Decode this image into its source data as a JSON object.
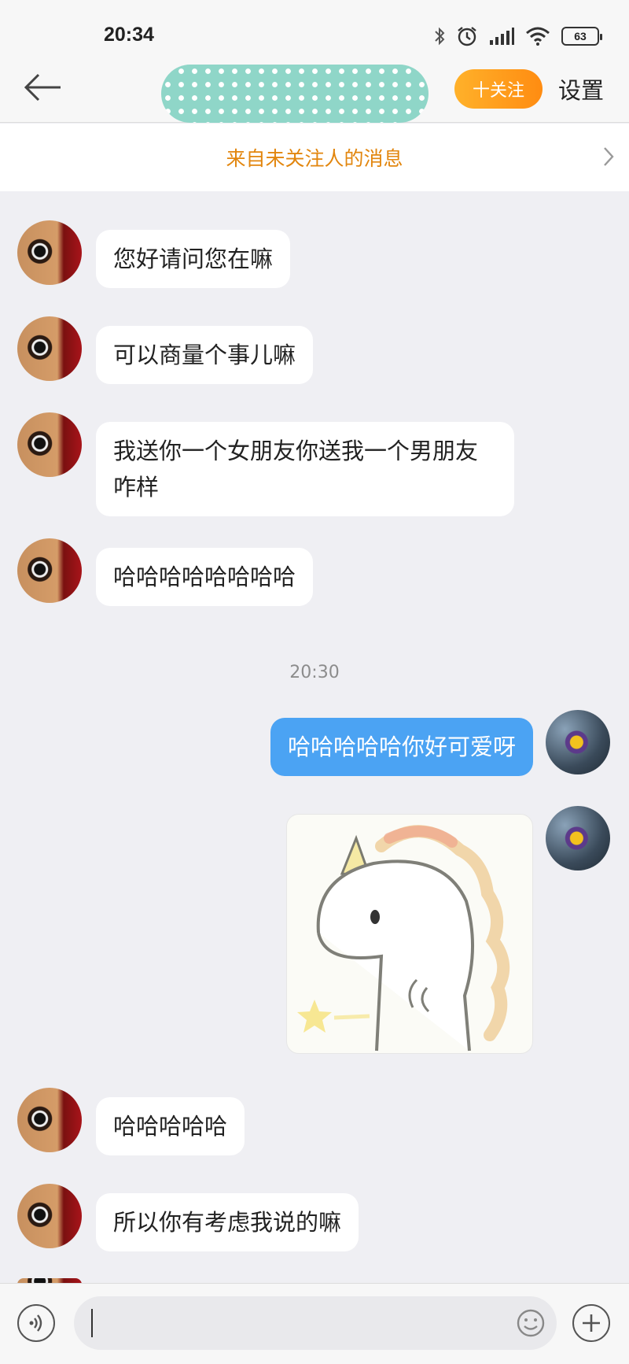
{
  "status_bar": {
    "time": "20:34",
    "battery": "63",
    "icons": [
      "bluetooth-icon",
      "alarm-icon",
      "signal-icon",
      "wifi-icon",
      "battery-icon"
    ]
  },
  "header": {
    "back_icon": "back-arrow-icon",
    "follow_label": "十关注",
    "settings_label": "设置"
  },
  "notice": {
    "text": "来自未关注人的消息",
    "chevron_icon": "chevron-right-icon"
  },
  "messages": [
    {
      "from": "them",
      "text": "您好请问您在嘛"
    },
    {
      "from": "them",
      "text": "可以商量个事儿嘛"
    },
    {
      "from": "them",
      "text": "我送你一个女朋友你送我一个男朋友咋样"
    },
    {
      "from": "them",
      "text": "哈哈哈哈哈哈哈哈"
    },
    {
      "type": "timestamp",
      "text": "20:30"
    },
    {
      "from": "me",
      "text": "哈哈哈哈哈你好可爱呀"
    },
    {
      "from": "me",
      "type": "sticker",
      "sticker": "unicorn-sticker"
    },
    {
      "from": "them",
      "text": "哈哈哈哈哈"
    },
    {
      "from": "them",
      "text": "所以你有考虑我说的嘛"
    }
  ],
  "input_bar": {
    "voice_icon": "voice-icon",
    "input_value": "",
    "emoji_icon": "emoji-icon",
    "plus_icon": "plus-icon"
  },
  "colors": {
    "accent_orange": "#ff8c11",
    "my_bubble": "#4ba3f3",
    "notice_text": "#e2860e",
    "chat_background": "#efeff3"
  }
}
